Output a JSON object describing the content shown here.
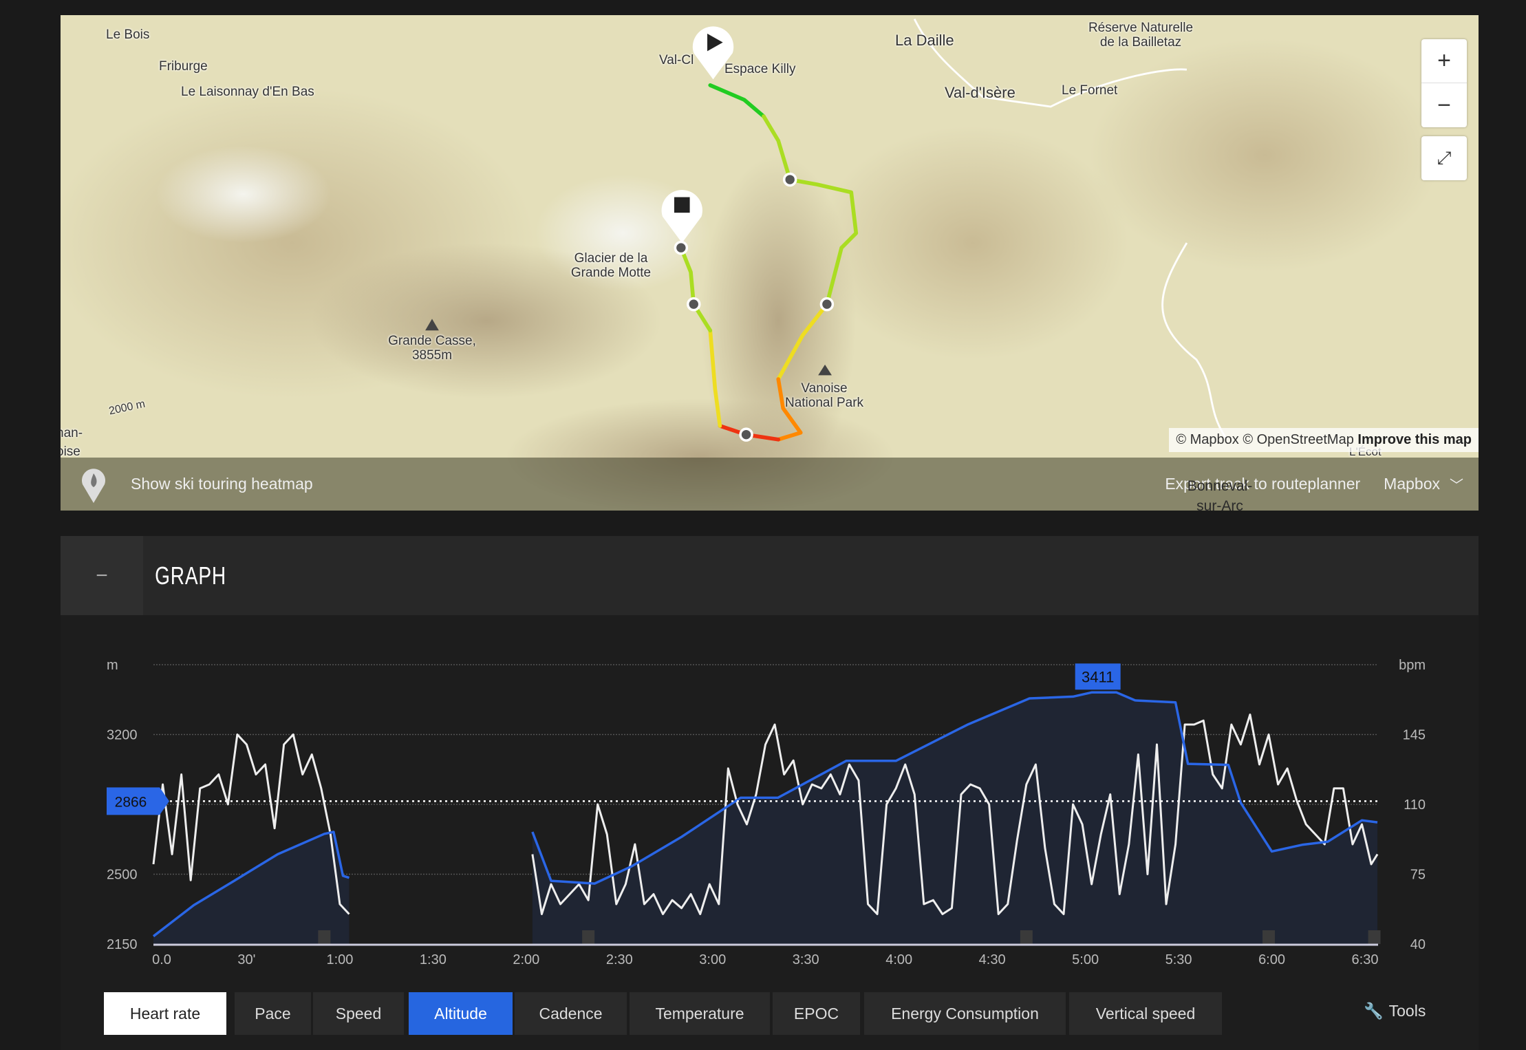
{
  "map": {
    "labels": [
      "Le Bois",
      "Friburge",
      "Le Laisonnay d'En Bas",
      "Val-Cl",
      "Espace Killy",
      "La Daille",
      "Réserve Naturelle de la Bailletaz",
      "Val-d'Isère",
      "Le Fornet",
      "Glacier de la Grande Motte",
      "Grande Casse, 3855m",
      "Vanoise National Park",
      "2000 m",
      "nan-",
      "oise",
      "L'Écot",
      "Bonneval-sur-Arc"
    ],
    "zoom_in": "+",
    "zoom_out": "−",
    "attribution": "© Mapbox © OpenStreetMap",
    "improve": "Improve this map",
    "heatmap_label": "Show ski touring heatmap",
    "export_label": "Export track to routeplanner",
    "style_select": "Mapbox",
    "route_colors": [
      "#22cc22",
      "#aadd22",
      "#eedd22",
      "#ff8800",
      "#ee3311"
    ]
  },
  "graph": {
    "collapse": "−",
    "title": "GRAPH"
  },
  "chart_data": {
    "type": "line",
    "left_unit": "m",
    "right_unit": "bpm",
    "left_ticks": [
      2150,
      2500,
      3200
    ],
    "right_ticks": [
      40,
      75,
      110,
      145
    ],
    "left_range": [
      2150,
      3550
    ],
    "right_range": [
      40,
      180
    ],
    "x_ticks": [
      "0.0",
      "30'",
      "1:00",
      "1:30",
      "2:00",
      "2:30",
      "3:00",
      "3:30",
      "4:00",
      "4:30",
      "5:00",
      "5:30",
      "6:00",
      "6:30"
    ],
    "x_range_min": [
      0,
      390
    ],
    "grid": true,
    "current_marker": "2866",
    "max_label": "3411",
    "max_time_min": 304,
    "colors": {
      "altitude": "#2a66e6",
      "heart_rate": "#eeeeee",
      "fill": "#1f2533"
    },
    "lap_markers_min": [
      55,
      140,
      281,
      359,
      393
    ],
    "altitude_segments": [
      [
        [
          0,
          2189
        ],
        [
          13,
          2345
        ],
        [
          26,
          2467
        ],
        [
          40,
          2600
        ],
        [
          55,
          2702
        ],
        [
          58,
          2712
        ],
        [
          61,
          2492
        ],
        [
          63,
          2482
        ]
      ],
      [
        [
          122,
          2712
        ],
        [
          128,
          2467
        ],
        [
          142,
          2453
        ],
        [
          154,
          2540
        ],
        [
          170,
          2687
        ],
        [
          189,
          2883
        ],
        [
          201,
          2883
        ],
        [
          223,
          3068
        ],
        [
          239,
          3068
        ],
        [
          262,
          3249
        ],
        [
          282,
          3381
        ],
        [
          296,
          3390
        ],
        [
          302,
          3411
        ],
        [
          310,
          3411
        ],
        [
          316,
          3371
        ],
        [
          329,
          3361
        ],
        [
          333,
          3053
        ],
        [
          346,
          3048
        ],
        [
          350,
          2858
        ],
        [
          360,
          2614
        ],
        [
          370,
          2648
        ],
        [
          378,
          2663
        ],
        [
          389,
          2770
        ],
        [
          394,
          2760
        ]
      ]
    ],
    "heart_rate_segments": [
      [
        [
          0,
          80
        ],
        [
          3,
          120
        ],
        [
          6,
          85
        ],
        [
          9,
          125
        ],
        [
          12,
          72
        ],
        [
          15,
          118
        ],
        [
          18,
          120
        ],
        [
          21,
          125
        ],
        [
          24,
          110
        ],
        [
          27,
          145
        ],
        [
          30,
          140
        ],
        [
          33,
          125
        ],
        [
          36,
          130
        ],
        [
          39,
          98
        ],
        [
          42,
          140
        ],
        [
          45,
          145
        ],
        [
          48,
          125
        ],
        [
          51,
          135
        ],
        [
          54,
          118
        ],
        [
          57,
          95
        ],
        [
          60,
          60
        ],
        [
          63,
          55
        ]
      ],
      [
        [
          122,
          85
        ],
        [
          125,
          55
        ],
        [
          128,
          70
        ],
        [
          131,
          60
        ],
        [
          134,
          65
        ],
        [
          137,
          70
        ],
        [
          140,
          62
        ],
        [
          143,
          110
        ],
        [
          146,
          95
        ],
        [
          149,
          60
        ],
        [
          152,
          70
        ],
        [
          155,
          90
        ],
        [
          158,
          60
        ],
        [
          161,
          65
        ],
        [
          164,
          55
        ],
        [
          167,
          62
        ],
        [
          170,
          58
        ],
        [
          173,
          65
        ],
        [
          176,
          55
        ],
        [
          179,
          70
        ],
        [
          182,
          60
        ],
        [
          185,
          128
        ],
        [
          188,
          110
        ],
        [
          191,
          100
        ],
        [
          194,
          115
        ],
        [
          197,
          140
        ],
        [
          200,
          150
        ],
        [
          203,
          125
        ],
        [
          206,
          132
        ],
        [
          209,
          110
        ],
        [
          212,
          120
        ],
        [
          215,
          118
        ],
        [
          218,
          125
        ],
        [
          221,
          115
        ],
        [
          224,
          130
        ],
        [
          227,
          122
        ],
        [
          230,
          60
        ],
        [
          233,
          55
        ],
        [
          236,
          110
        ],
        [
          239,
          118
        ],
        [
          242,
          130
        ],
        [
          245,
          115
        ],
        [
          248,
          60
        ],
        [
          251,
          62
        ],
        [
          254,
          55
        ],
        [
          257,
          58
        ],
        [
          260,
          115
        ],
        [
          263,
          120
        ],
        [
          266,
          118
        ],
        [
          269,
          110
        ],
        [
          272,
          55
        ],
        [
          275,
          60
        ],
        [
          278,
          92
        ],
        [
          281,
          120
        ],
        [
          284,
          130
        ],
        [
          287,
          88
        ],
        [
          290,
          60
        ],
        [
          293,
          55
        ],
        [
          296,
          110
        ],
        [
          299,
          100
        ],
        [
          302,
          70
        ],
        [
          305,
          95
        ],
        [
          308,
          115
        ],
        [
          311,
          65
        ],
        [
          314,
          90
        ],
        [
          317,
          135
        ],
        [
          320,
          75
        ],
        [
          323,
          140
        ],
        [
          326,
          60
        ],
        [
          329,
          90
        ],
        [
          332,
          150
        ],
        [
          335,
          150
        ],
        [
          338,
          152
        ],
        [
          341,
          125
        ],
        [
          344,
          118
        ],
        [
          347,
          150
        ],
        [
          350,
          140
        ],
        [
          353,
          155
        ],
        [
          356,
          130
        ],
        [
          359,
          145
        ],
        [
          362,
          120
        ],
        [
          365,
          128
        ],
        [
          368,
          112
        ],
        [
          371,
          100
        ],
        [
          374,
          95
        ],
        [
          377,
          90
        ],
        [
          380,
          118
        ],
        [
          383,
          118
        ],
        [
          386,
          90
        ],
        [
          389,
          100
        ],
        [
          392,
          80
        ],
        [
          394,
          85
        ]
      ]
    ]
  },
  "tabs": [
    "Heart rate",
    "Pace",
    "Speed",
    "Altitude",
    "Cadence",
    "Temperature",
    "EPOC",
    "Energy Consumption",
    "Vertical speed"
  ],
  "tools_label": "Tools"
}
